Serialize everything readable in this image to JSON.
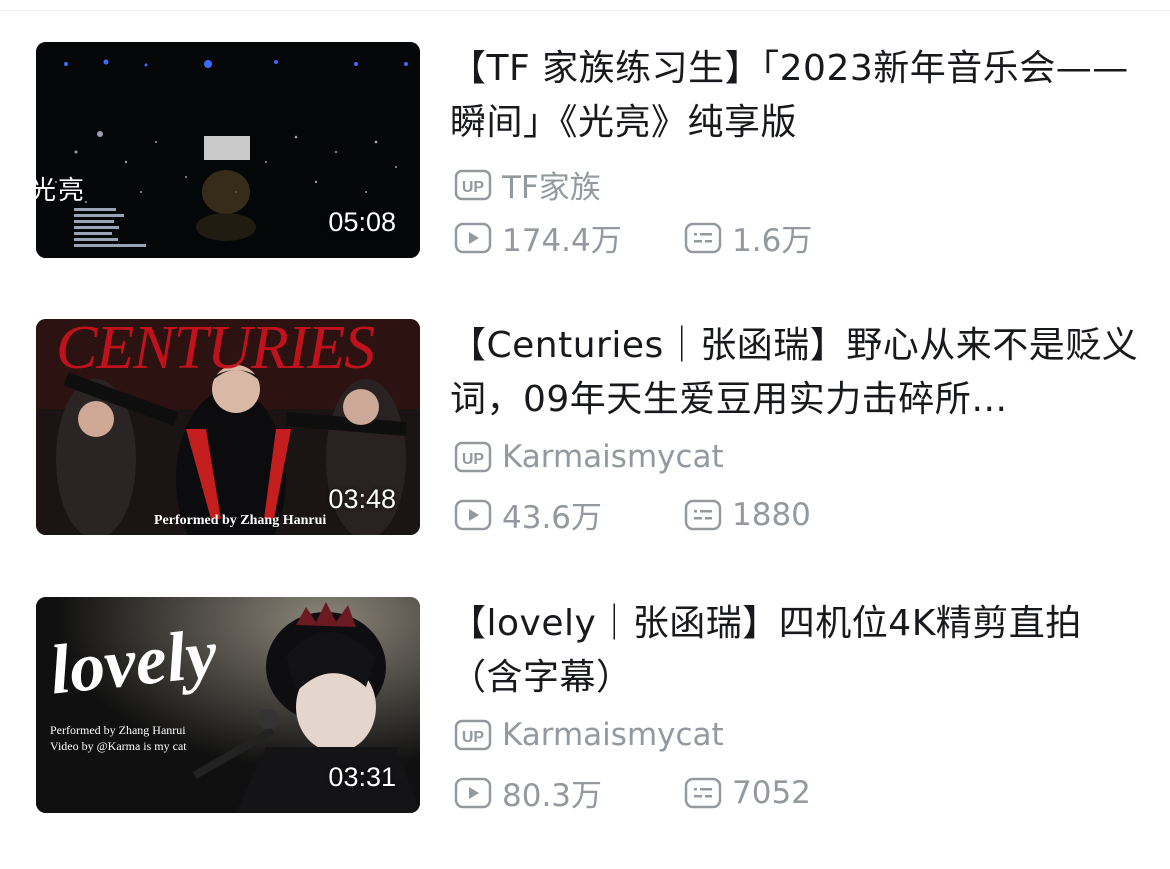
{
  "videos": [
    {
      "title": "【TF  家族练习生】「2023新年音乐会——瞬间」《光亮》纯享版",
      "uploader": "TF家族",
      "views": "174.4万",
      "danmaku": "1.6万",
      "duration": "05:08",
      "thumb_overlay": "光亮"
    },
    {
      "title": "【Centuries｜张函瑞】野心从来不是贬义词，09年天生爱豆用实力击碎所…",
      "uploader": "Karmaismycat",
      "views": "43.6万",
      "danmaku": "1880",
      "duration": "03:48",
      "thumb_overlay": "CENTURIES",
      "thumb_credit": "Performed by Zhang Hanrui"
    },
    {
      "title": "【lovely｜张函瑞】四机位4K精剪直拍（含字幕）",
      "uploader": "Karmaismycat",
      "views": "80.3万",
      "danmaku": "7052",
      "duration": "03:31",
      "thumb_overlay": "lovely",
      "thumb_credit": "Performed by Zhang Hanrui",
      "thumb_credit2": "Video by @Karma is my cat"
    }
  ],
  "icons": {
    "uploader": "up-badge-icon",
    "views": "play-count-icon",
    "danmaku": "danmaku-icon"
  },
  "colors": {
    "title": "#18191c",
    "meta": "#9499a0",
    "centuries_red": "#c8141e"
  }
}
